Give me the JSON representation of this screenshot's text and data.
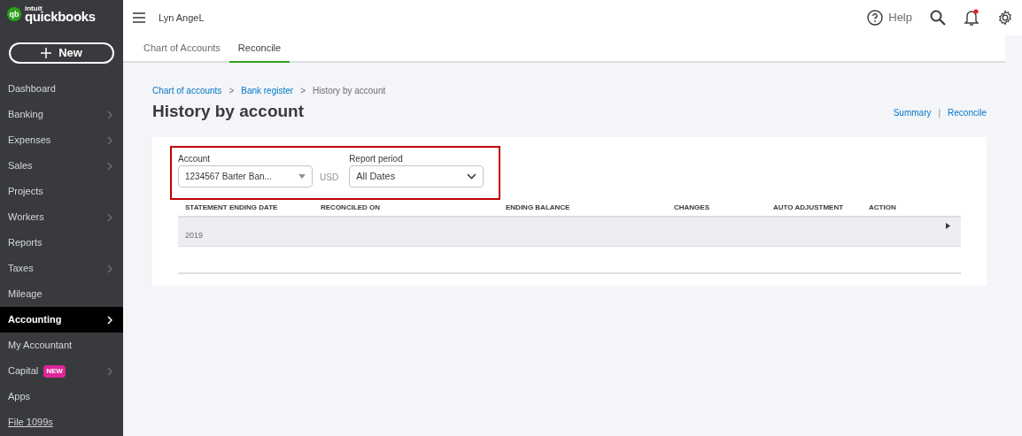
{
  "logo": {
    "mark": "qb",
    "vendor": "intuit",
    "name": "quickbooks"
  },
  "new_button": {
    "label": "New"
  },
  "sidebar": {
    "items": [
      {
        "label": "Dashboard",
        "selected": false,
        "chevron": false
      },
      {
        "label": "Banking",
        "selected": false,
        "chevron": true
      },
      {
        "label": "Expenses",
        "selected": false,
        "chevron": true
      },
      {
        "label": "Sales",
        "selected": false,
        "chevron": true
      },
      {
        "label": "Projects",
        "selected": false,
        "chevron": false
      },
      {
        "label": "Workers",
        "selected": false,
        "chevron": true
      },
      {
        "label": "Reports",
        "selected": false,
        "chevron": false
      },
      {
        "label": "Taxes",
        "selected": false,
        "chevron": true
      },
      {
        "label": "Mileage",
        "selected": false,
        "chevron": false
      },
      {
        "label": "Accounting",
        "selected": true,
        "chevron": true
      },
      {
        "label": "My Accountant",
        "selected": false,
        "chevron": false
      },
      {
        "label": "Capital",
        "selected": false,
        "chevron": true,
        "badge": "NEW"
      },
      {
        "label": "Apps",
        "selected": false,
        "chevron": false
      },
      {
        "label": "File 1099s",
        "selected": false,
        "chevron": false,
        "kind": "link"
      }
    ]
  },
  "header": {
    "company": "Lyn AngeL",
    "help": "Help",
    "notification": true
  },
  "tabs": [
    {
      "label": "Chart of Accounts",
      "selected": false
    },
    {
      "label": "Reconcile",
      "selected": true
    }
  ],
  "breadcrumbs": [
    {
      "label": "Chart of accounts",
      "kind": "link"
    },
    {
      "label": ">",
      "kind": "sep"
    },
    {
      "label": "Bank register",
      "kind": "link"
    },
    {
      "label": ">",
      "kind": "sep"
    },
    {
      "label": "History by account",
      "kind": "current"
    }
  ],
  "page_title": "History by account",
  "page_links": [
    "Summary",
    "|",
    "Reconcile"
  ],
  "filters": {
    "account_label": "Account",
    "account_value": "1234567 Barter Ban...",
    "currency": "USD",
    "period_label": "Report period",
    "period_value": "All Dates"
  },
  "table": {
    "columns": [
      "STATEMENT ENDING DATE",
      "RECONCILED ON",
      "ENDING BALANCE",
      "CHANGES",
      "AUTO ADJUSTMENT",
      "ACTION"
    ],
    "groups": [
      {
        "label": "2019",
        "expanded": false
      }
    ]
  }
}
